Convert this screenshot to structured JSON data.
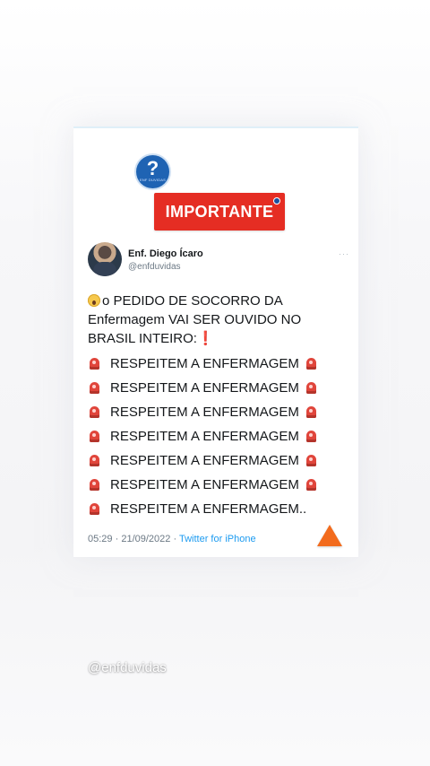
{
  "logo": {
    "symbol": "?",
    "tiny_text": "ENF DUVIDAS",
    "color": "#1f63b3"
  },
  "banner": {
    "label": "IMPORTANTE",
    "color": "#e52d23"
  },
  "tweet": {
    "author_name": "Enf. Diego Ícaro",
    "author_handle": "@enfduvidas",
    "more_icon": "···",
    "intro_emoji": "scream-emoji",
    "intro_text": "o PEDIDO DE SOCORRO DA Enfermagem VAI SER OUVIDO NO BRASIL INTEIRO:",
    "intro_exclamation": "❗",
    "lines": [
      "RESPEITEM A ENFERMAGEM",
      "RESPEITEM A ENFERMAGEM",
      "RESPEITEM A ENFERMAGEM",
      "RESPEITEM A ENFERMAGEM",
      "RESPEITEM A ENFERMAGEM",
      "RESPEITEM A ENFERMAGEM",
      "RESPEITEM A ENFERMAGEM.."
    ],
    "line_icon": "rotating-light-icon",
    "time": "05:29",
    "separator": "·",
    "date": "21/09/2022",
    "source": "Twitter for iPhone"
  },
  "overlay": {
    "warning_icon": "orange-triangle-icon",
    "watermark": "@enfduvidas"
  }
}
